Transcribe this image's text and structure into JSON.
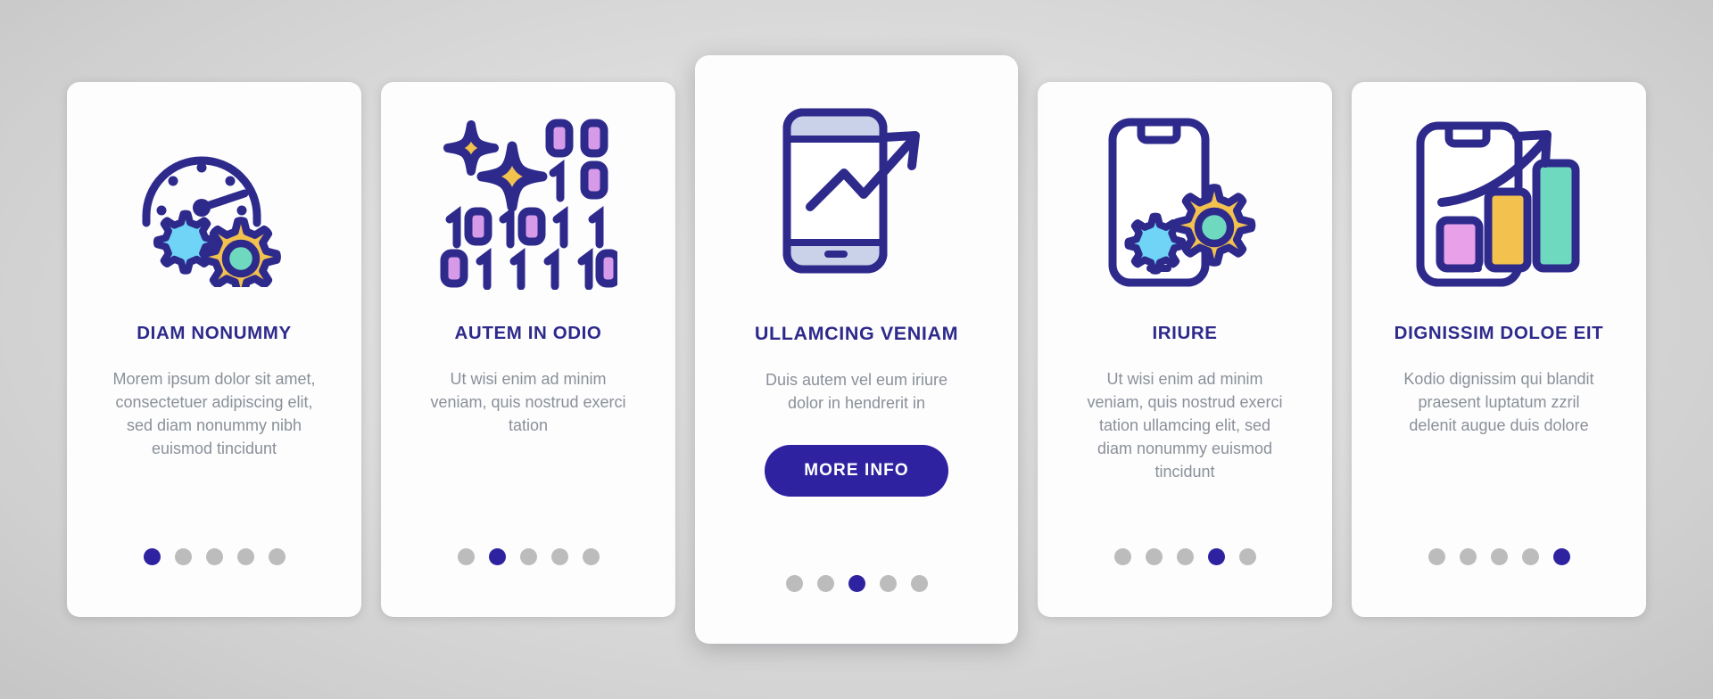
{
  "palette": {
    "indigo": "#2e2a8c",
    "button_indigo": "#2e22a0",
    "yellow": "#f2c14e",
    "light_blue": "#6fd4f5",
    "teal": "#6fd9c0",
    "pink": "#e8a0e8",
    "violet": "#d79ae8",
    "screen_gray": "#c9d2e8",
    "dot_inactive": "#bcbcbc",
    "body_text": "#8a9099",
    "card_bg": "#fdfdfd",
    "page_bg": "#cfcfcf"
  },
  "cards": [
    {
      "icon": "speedometer-gears-icon",
      "title": "DIAM NONUMMY",
      "description": "Morem ipsum dolor sit amet, consectetuer adipiscing elit, sed diam nonummy nibh euismod tincidunt",
      "featured": false,
      "dots": {
        "count": 5,
        "active_index": 0
      }
    },
    {
      "icon": "binary-sparkle-icon",
      "title": "AUTEM IN ODIO",
      "description": "Ut wisi enim ad minim veniam, quis nostrud exerci tation",
      "featured": false,
      "binary_rows": [
        "00",
        "10",
        "101011",
        "011110"
      ],
      "dots": {
        "count": 5,
        "active_index": 1
      }
    },
    {
      "icon": "phone-growth-arrow-icon",
      "title": "ULLAMCING VENIAM",
      "description": "Duis autem vel eum iriure dolor in hendrerit in",
      "featured": true,
      "cta_label": "MORE INFO",
      "dots": {
        "count": 5,
        "active_index": 2
      }
    },
    {
      "icon": "phone-settings-gears-icon",
      "title": "IRIURE",
      "description": "Ut wisi enim ad minim veniam, quis nostrud exerci tation ullamcing elit, sed diam nonummy euismod tincidunt",
      "featured": false,
      "dots": {
        "count": 5,
        "active_index": 3
      }
    },
    {
      "icon": "phone-bar-chart-arrow-icon",
      "title": "DIGNISSIM DOLOE EIT",
      "description": "Kodio dignissim qui blandit praesent luptatum zzril delenit augue duis dolore",
      "featured": false,
      "dots": {
        "count": 5,
        "active_index": 4
      }
    }
  ]
}
